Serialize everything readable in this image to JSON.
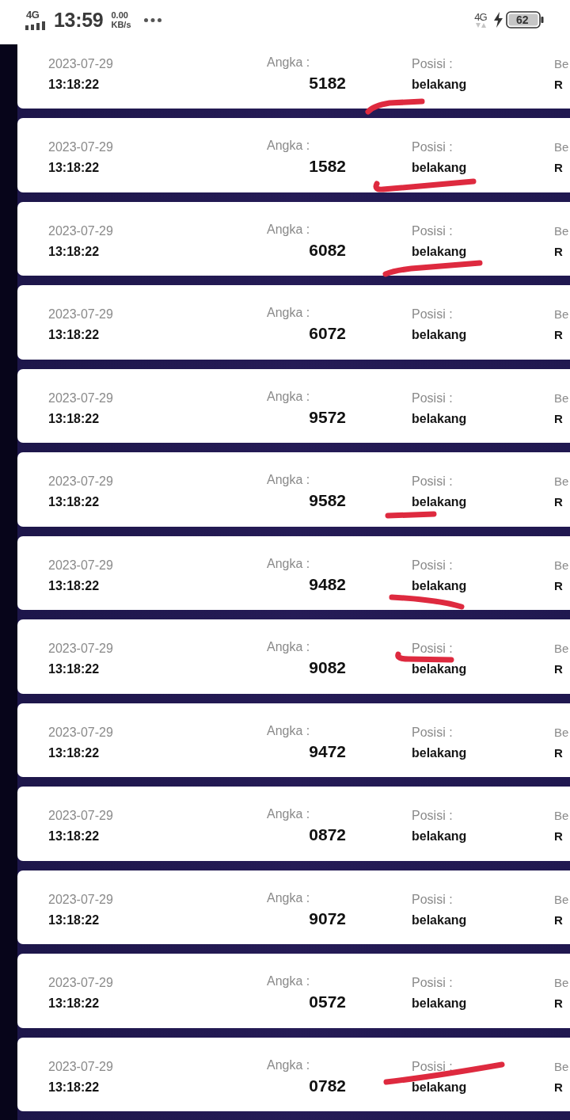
{
  "status_bar": {
    "network": "4G",
    "time": "13:59",
    "speed": "0.00",
    "speed_unit": "KB/s",
    "network_right": "4G",
    "battery": "62"
  },
  "records": [
    {
      "date": "2023-07-29",
      "time": "13:18:22",
      "angka_label": "Angka :",
      "angka": "5182",
      "posisi_label": "Posisi :",
      "posisi": "belakang",
      "column_4_label": "Be",
      "column_4_value": "R",
      "scribble": {
        "kind": "hook"
      }
    },
    {
      "date": "2023-07-29",
      "time": "13:18:22",
      "angka_label": "Angka :",
      "angka": "1582",
      "posisi_label": "Posisi :",
      "posisi": "belakang",
      "column_4_label": "Be",
      "column_4_value": "R",
      "scribble": {
        "kind": "underline"
      }
    },
    {
      "date": "2023-07-29",
      "time": "13:18:22",
      "angka_label": "Angka :",
      "angka": "6082",
      "posisi_label": "Posisi :",
      "posisi": "belakang",
      "column_4_label": "Be",
      "column_4_value": "R",
      "scribble": {
        "kind": "rising"
      }
    },
    {
      "date": "2023-07-29",
      "time": "13:18:22",
      "angka_label": "Angka :",
      "angka": "6072",
      "posisi_label": "Posisi :",
      "posisi": "belakang",
      "column_4_label": "Be",
      "column_4_value": "R"
    },
    {
      "date": "2023-07-29",
      "time": "13:18:22",
      "angka_label": "Angka :",
      "angka": "9572",
      "posisi_label": "Posisi :",
      "posisi": "belakang",
      "column_4_label": "Be",
      "column_4_value": "R"
    },
    {
      "date": "2023-07-29",
      "time": "13:18:22",
      "angka_label": "Angka :",
      "angka": "9582",
      "posisi_label": "Posisi :",
      "posisi": "belakang",
      "column_4_label": "Be",
      "column_4_value": "R",
      "scribble": {
        "kind": "dash"
      }
    },
    {
      "date": "2023-07-29",
      "time": "13:18:22",
      "angka_label": "Angka :",
      "angka": "9482",
      "posisi_label": "Posisi :",
      "posisi": "belakang",
      "column_4_label": "Be",
      "column_4_value": "R",
      "scribble": {
        "kind": "sag"
      }
    },
    {
      "date": "2023-07-29",
      "time": "13:18:22",
      "angka_label": "Angka :",
      "angka": "9082",
      "posisi_label": "Posisi :",
      "posisi": "belakang",
      "column_4_label": "Be",
      "column_4_value": "R",
      "scribble": {
        "kind": "gap"
      }
    },
    {
      "date": "2023-07-29",
      "time": "13:18:22",
      "angka_label": "Angka :",
      "angka": "9472",
      "posisi_label": "Posisi :",
      "posisi": "belakang",
      "column_4_label": "Be",
      "column_4_value": "R"
    },
    {
      "date": "2023-07-29",
      "time": "13:18:22",
      "angka_label": "Angka :",
      "angka": "0872",
      "posisi_label": "Posisi :",
      "posisi": "belakang",
      "column_4_label": "Be",
      "column_4_value": "R"
    },
    {
      "date": "2023-07-29",
      "time": "13:18:22",
      "angka_label": "Angka :",
      "angka": "9072",
      "posisi_label": "Posisi :",
      "posisi": "belakang",
      "column_4_label": "Be",
      "column_4_value": "R"
    },
    {
      "date": "2023-07-29",
      "time": "13:18:22",
      "angka_label": "Angka :",
      "angka": "0572",
      "posisi_label": "Posisi :",
      "posisi": "belakang",
      "column_4_label": "Be",
      "column_4_value": "R"
    },
    {
      "date": "2023-07-29",
      "time": "13:18:22",
      "angka_label": "Angka :",
      "angka": "0782",
      "posisi_label": "Posisi :",
      "posisi": "belakang",
      "column_4_label": "Be",
      "column_4_value": "R",
      "scribble": {
        "kind": "slash"
      }
    }
  ]
}
